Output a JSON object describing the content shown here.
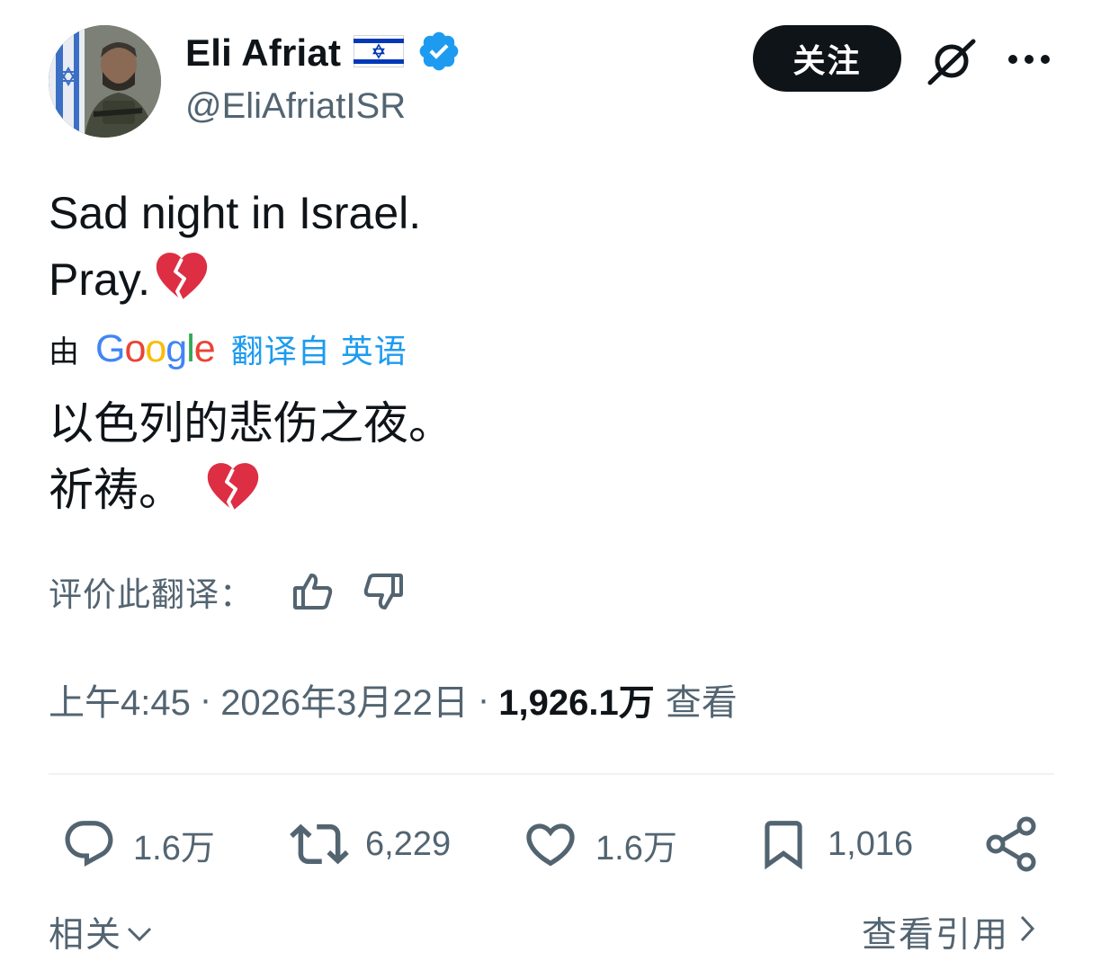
{
  "author": {
    "display_name": "Eli Afriat",
    "flag_icon": "israel-flag-icon",
    "verified_icon": "verified-badge-icon",
    "handle": "@EliAfriatISR"
  },
  "header": {
    "follow_label": "关注",
    "grok_icon": "grok-icon",
    "more_icon": "more-icon"
  },
  "tweet": {
    "line1": "Sad night in Israel.",
    "line2": "Pray.",
    "emoji": "broken-heart-icon"
  },
  "translation": {
    "by_label": "由",
    "provider": "Google",
    "translated_from": "翻译自 英语",
    "line1": "以色列的悲伤之夜。",
    "line2": "祈祷。",
    "rate_label": "评价此翻译："
  },
  "meta": {
    "time": "上午4:45",
    "separator": "·",
    "date": "2026年3月22日",
    "views_count": "1,926.1万",
    "views_label": "查看"
  },
  "actions": {
    "replies": "1.6万",
    "retweets": "6,229",
    "likes": "1.6万",
    "bookmarks": "1,016"
  },
  "footer": {
    "related_label": "相关",
    "quotes_label": "查看引用"
  },
  "colors": {
    "text": "#0f1419",
    "secondary": "#536471",
    "link": "#1d9bf0",
    "verified": "#1d9bf0",
    "broken_heart": "#dd2e44"
  }
}
